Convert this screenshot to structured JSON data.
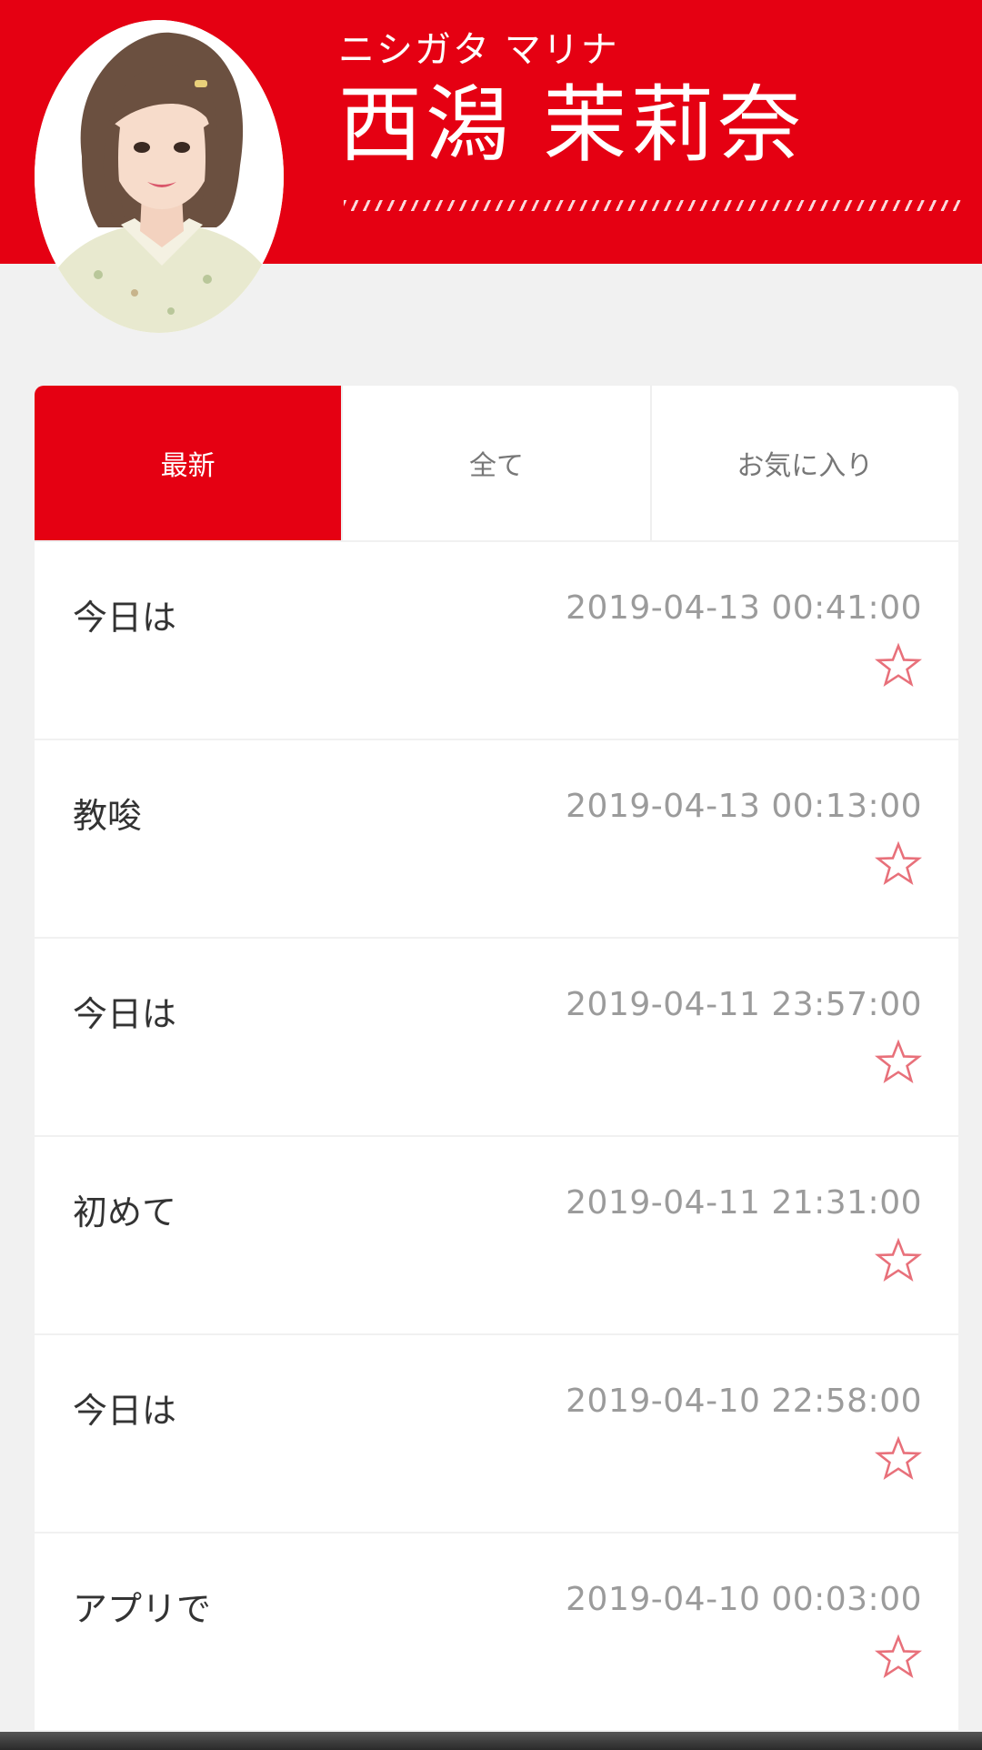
{
  "profile": {
    "kana": "ニシガタ マリナ",
    "name": "西潟 茉莉奈"
  },
  "tabs": [
    {
      "label": "最新",
      "active": true
    },
    {
      "label": "全て",
      "active": false
    },
    {
      "label": "お気に入り",
      "active": false
    }
  ],
  "posts": [
    {
      "title": "今日は",
      "date": "2019-04-13 00:41:00",
      "favorite": false
    },
    {
      "title": "教唆",
      "date": "2019-04-13 00:13:00",
      "favorite": false
    },
    {
      "title": "今日は",
      "date": "2019-04-11 23:57:00",
      "favorite": false
    },
    {
      "title": "初めて",
      "date": "2019-04-11 21:31:00",
      "favorite": false
    },
    {
      "title": "今日は",
      "date": "2019-04-10 22:58:00",
      "favorite": false
    },
    {
      "title": "アプリで",
      "date": "2019-04-10 00:03:00",
      "favorite": false
    }
  ],
  "icons": {
    "favorite": "star-outline-icon"
  },
  "colors": {
    "brand_red": "#e50012",
    "star_outline": "#e8707a"
  }
}
